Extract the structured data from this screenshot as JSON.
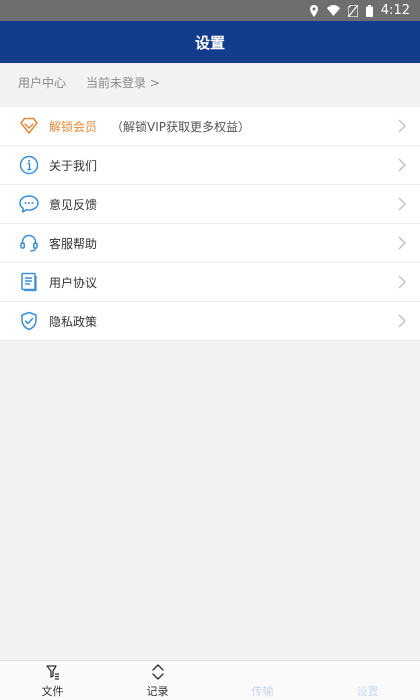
{
  "status_bar": {
    "time": "4:12"
  },
  "header": {
    "title": "设置"
  },
  "user_center": {
    "title": "用户中心",
    "status": "当前未登录 >"
  },
  "menu": {
    "items": [
      {
        "icon": "diamond-icon",
        "label": "解锁会员",
        "sub": "（解锁VIP获取更多权益）"
      },
      {
        "icon": "info-icon",
        "label": "关于我们"
      },
      {
        "icon": "chat-icon",
        "label": "意见反馈"
      },
      {
        "icon": "headset-icon",
        "label": "客服帮助"
      },
      {
        "icon": "document-icon",
        "label": "用户协议"
      },
      {
        "icon": "shield-icon",
        "label": "隐私政策"
      }
    ]
  },
  "bottom_nav": {
    "tabs": [
      {
        "icon": "file-filter-icon",
        "label": "文件"
      },
      {
        "icon": "chevrons-updown-icon",
        "label": "记录"
      },
      {
        "icon": "",
        "label": "传输"
      },
      {
        "icon": "",
        "label": "设置"
      }
    ]
  },
  "colors": {
    "appbar": "#143c8c",
    "vip": "#e08a3a",
    "icon_blue": "#3b8fd4"
  }
}
